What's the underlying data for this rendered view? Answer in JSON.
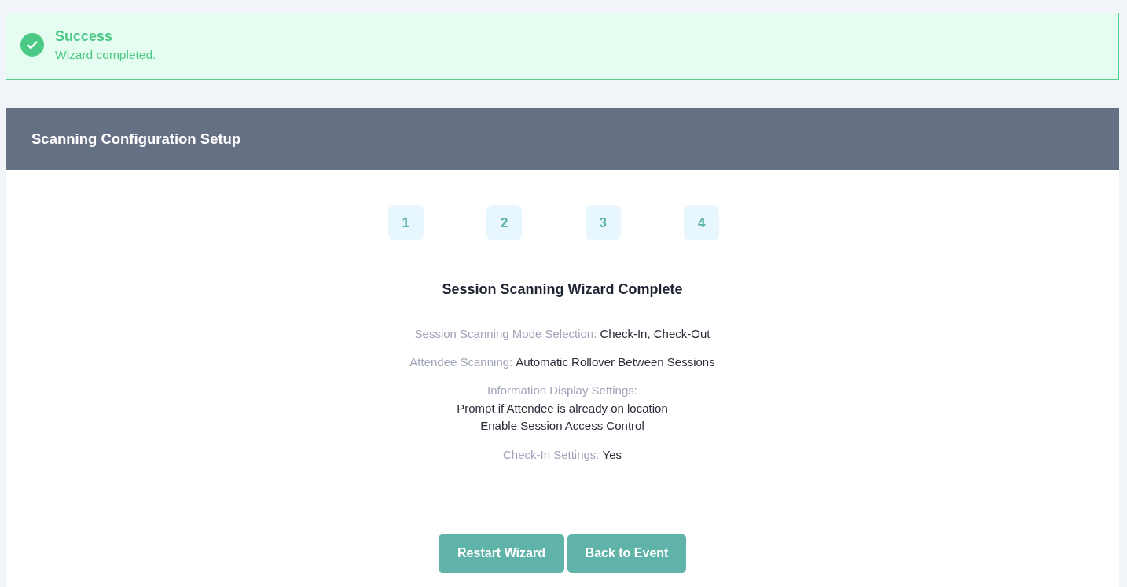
{
  "alert": {
    "kind": "success",
    "title": "Success",
    "message": "Wizard completed."
  },
  "panel": {
    "title": "Scanning Configuration Setup"
  },
  "steps": [
    {
      "label": "1"
    },
    {
      "label": "2"
    },
    {
      "label": "3"
    },
    {
      "label": "4"
    }
  ],
  "summary": {
    "heading": "Session Scanning Wizard Complete",
    "items": [
      {
        "kind": "inline",
        "label": "Session Scanning Mode Selection:",
        "values": [
          "Check-In, Check-Out"
        ]
      },
      {
        "kind": "inline",
        "label": "Attendee Scanning:",
        "values": [
          "Automatic Rollover Between Sessions"
        ]
      },
      {
        "kind": "stacked",
        "label": "Information Display Settings:",
        "values": [
          "Prompt if Attendee is already on location",
          "Enable Session Access Control"
        ]
      },
      {
        "kind": "inline",
        "label": "Check-In Settings:",
        "values": [
          "Yes"
        ]
      }
    ]
  },
  "buttons": [
    "Restart Wizard",
    "Back to Event"
  ]
}
